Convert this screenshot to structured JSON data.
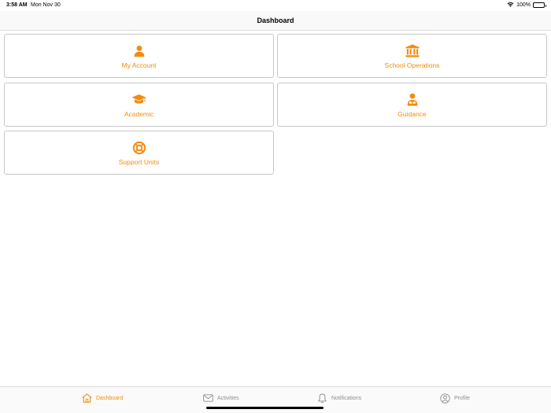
{
  "status_bar": {
    "time": "3:58 AM",
    "date": "Mon Nov 30",
    "battery": "100%"
  },
  "nav": {
    "title": "Dashboard"
  },
  "cards": {
    "my_account": "My Account",
    "school_operations": "School Operations",
    "academic": "Academic",
    "guidance": "Guidance",
    "support_units": "Support Units"
  },
  "tabs": {
    "dashboard": "Dashboard",
    "activities": "Activities",
    "notifications": "Notifications",
    "profile": "Profile"
  },
  "colors": {
    "accent": "#f28c0f",
    "inactive": "#8e8e93",
    "border": "#c8c8c8"
  },
  "icons": {
    "my_account": "person-icon",
    "school_operations": "institution-icon",
    "academic": "graduation-cap-icon",
    "guidance": "counselor-icon",
    "support_units": "lifebuoy-icon"
  }
}
